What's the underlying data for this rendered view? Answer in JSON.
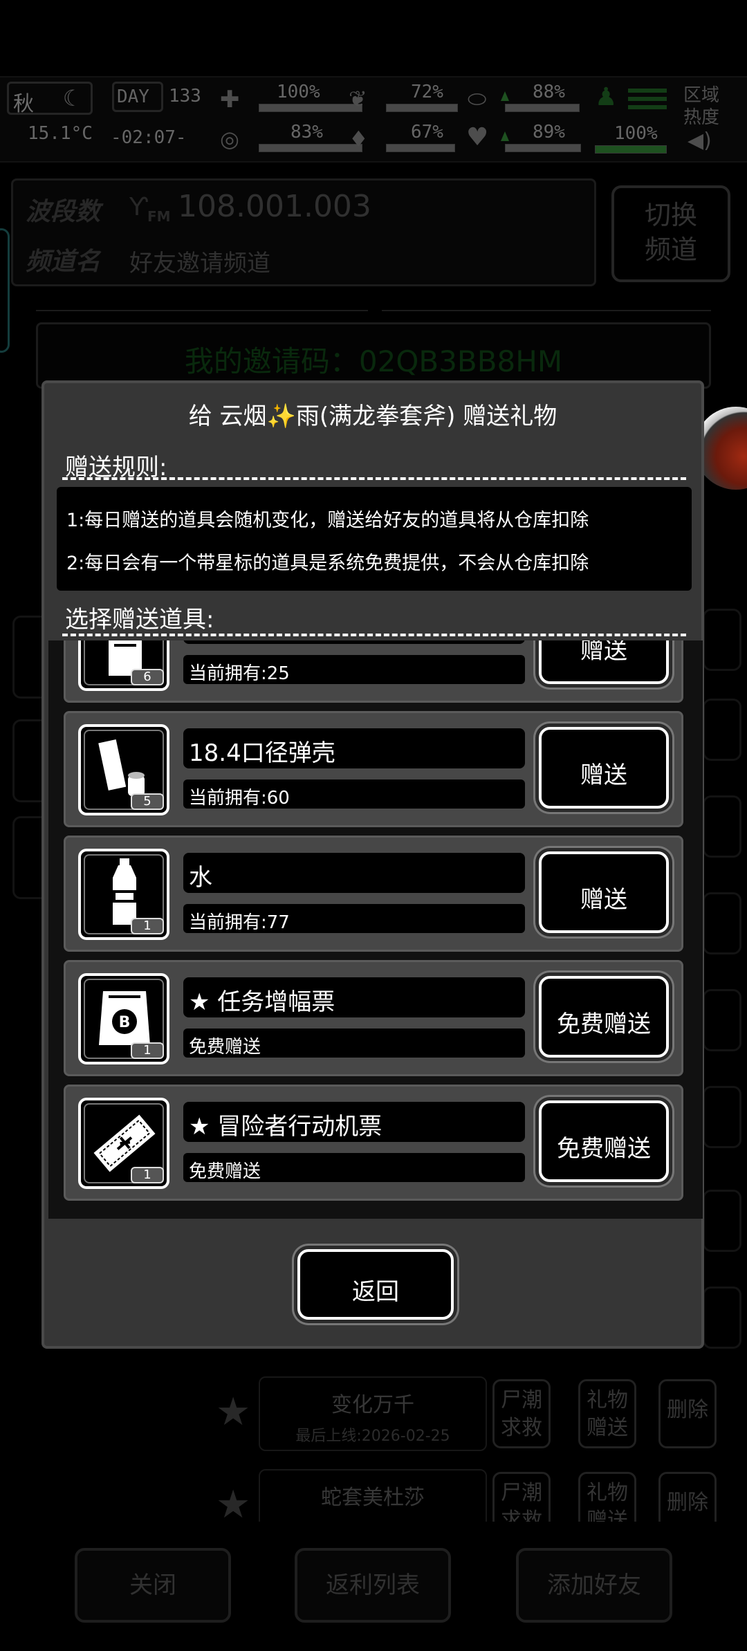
{
  "status_bar": {
    "season": "秋",
    "temperature": "15.1°C",
    "day_label": "DAY",
    "day_number": "133",
    "clock": "-02:07-",
    "stats": [
      {
        "icon": "medkit-icon",
        "value": "100%"
      },
      {
        "icon": "brain-icon",
        "value": "83%"
      },
      {
        "icon": "stomach-icon",
        "value": "72%"
      },
      {
        "icon": "water-drop-icon",
        "value": "67%"
      },
      {
        "icon": "pill-icon",
        "value": "88%"
      },
      {
        "icon": "heart-icon",
        "value": "89%"
      }
    ],
    "player_level": "100%",
    "region_heat_label": "区域\n热度"
  },
  "radio": {
    "band_label": "波段数",
    "band_value": "108.001.003",
    "fm_label": "FM",
    "channel_label": "频道名",
    "channel_value": "好友邀请频道",
    "switch_button": "切换\n频道",
    "invite_code_text": "我的邀请码：02QB3BB8HM"
  },
  "friends": [
    {
      "name": "变化万千",
      "last_online": "最后上线:2026-02-25",
      "buttons": [
        "尸潮\n求救",
        "礼物\n赠送",
        "删除"
      ]
    },
    {
      "name": "蛇套美杜莎",
      "last_online": "",
      "buttons": [
        "尸潮\n求救",
        "礼物\n赠送",
        "删除"
      ]
    }
  ],
  "bottom_bar": {
    "close": "关闭",
    "rebate_list": "返利列表",
    "add_friend": "添加好友"
  },
  "modal": {
    "title": "给 云烟✨雨(满龙拳套斧) 赠送礼物",
    "rules_title": "赠送规则:",
    "rules": [
      "1:每日赠送的道具会随机变化，赠送给好友的道具将从仓库扣除",
      "2:每日会有一个带星标的道具是系统免费提供，不会从仓库扣除"
    ],
    "select_title": "选择赠送道具:",
    "items": [
      {
        "name": "",
        "owned": "当前拥有:25",
        "count": "6",
        "icon": "bottle-icon",
        "button": "赠送",
        "starred": false
      },
      {
        "name": "18.4口径弹壳",
        "owned": "当前拥有:60",
        "count": "5",
        "icon": "shell-casing-icon",
        "button": "赠送",
        "starred": false
      },
      {
        "name": "水",
        "owned": "当前拥有:77",
        "count": "1",
        "icon": "water-bottle-icon",
        "button": "赠送",
        "starred": false
      },
      {
        "name": "任务增幅票",
        "owned": "免费赠送",
        "count": "1",
        "icon": "ticket-bag-icon",
        "button": "免费赠送",
        "starred": true
      },
      {
        "name": "冒险者行动机票",
        "owned": "免费赠送",
        "count": "1",
        "icon": "plane-ticket-icon",
        "button": "免费赠送",
        "starred": true
      }
    ],
    "back_button": "返回"
  }
}
